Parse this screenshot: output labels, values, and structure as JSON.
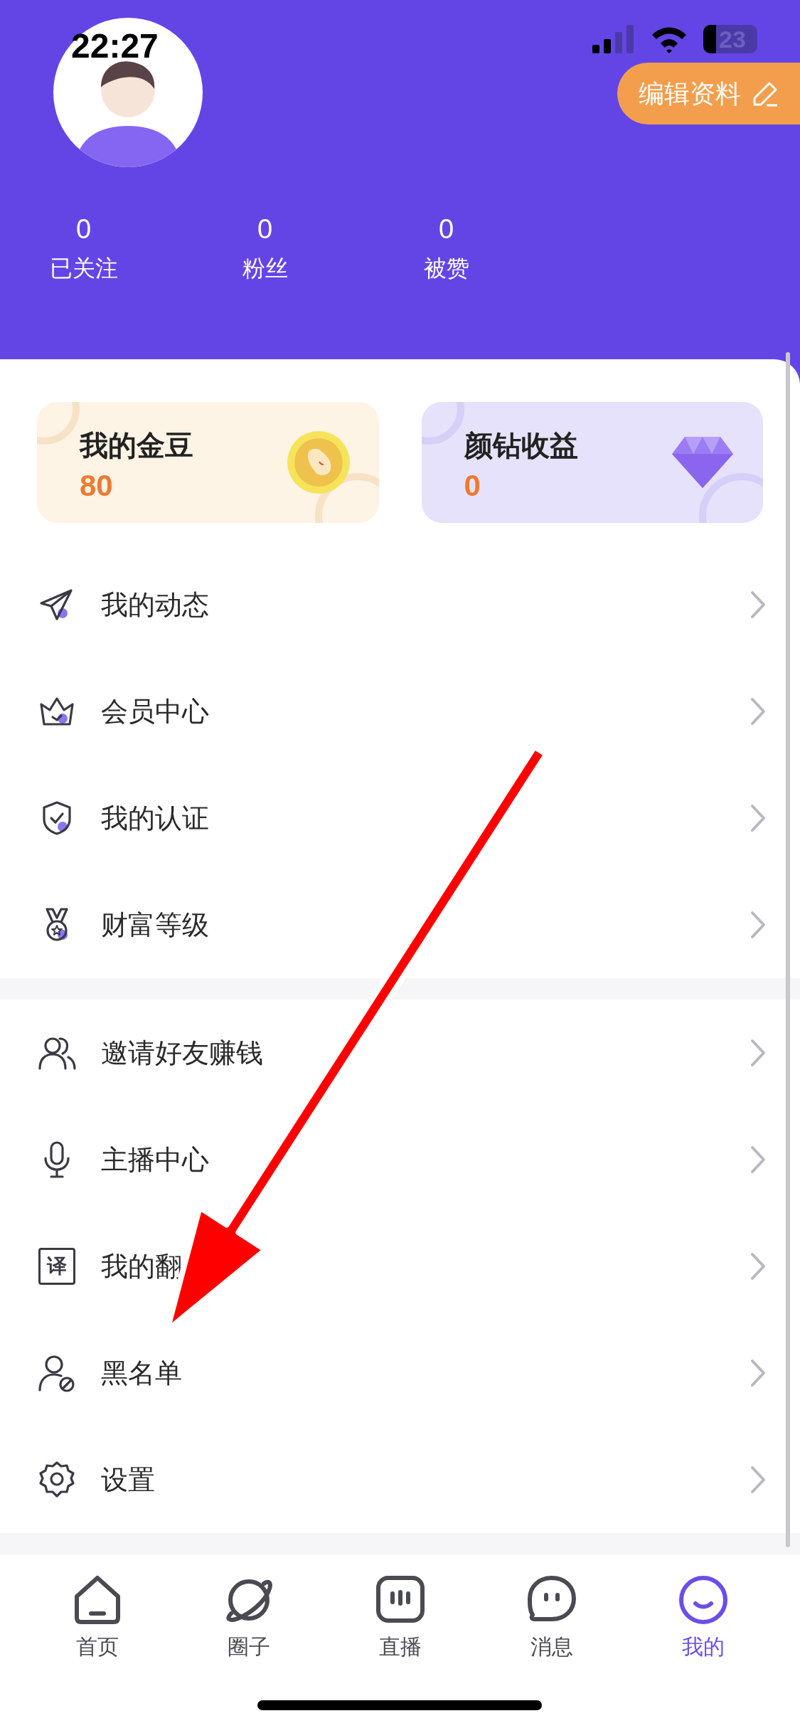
{
  "status_bar": {
    "time": "22:27",
    "battery": "23"
  },
  "profile": {
    "edit_button": "编辑资料"
  },
  "stats": [
    {
      "value": "0",
      "label": "已关注"
    },
    {
      "value": "0",
      "label": "粉丝"
    },
    {
      "value": "0",
      "label": "被赞"
    }
  ],
  "wallet_cards": [
    {
      "kind": "beans",
      "title": "我的金豆",
      "value": "80"
    },
    {
      "kind": "diamonds",
      "title": "颜钻收益",
      "value": "0"
    }
  ],
  "menu_groups": [
    {
      "items": [
        {
          "kind": "plane",
          "label": "我的动态"
        },
        {
          "kind": "crown",
          "label": "会员中心"
        },
        {
          "kind": "shield",
          "label": "我的认证"
        },
        {
          "kind": "medal",
          "label": "财富等级"
        }
      ]
    },
    {
      "items": [
        {
          "kind": "users",
          "label": "邀请好友赚钱"
        },
        {
          "kind": "mic",
          "label": "主播中心"
        },
        {
          "kind": "translate",
          "label": "我的翻",
          "icon_text": "译"
        },
        {
          "kind": "block",
          "label": "黑名单"
        },
        {
          "kind": "gear",
          "label": "设置"
        }
      ]
    }
  ],
  "tab_bar": [
    {
      "kind": "home",
      "label": "首页",
      "selected": false
    },
    {
      "kind": "planet",
      "label": "圈子",
      "selected": false
    },
    {
      "kind": "live",
      "label": "直播",
      "selected": false
    },
    {
      "kind": "chat",
      "label": "消息",
      "selected": false
    },
    {
      "kind": "me",
      "label": "我的",
      "selected": true
    }
  ]
}
